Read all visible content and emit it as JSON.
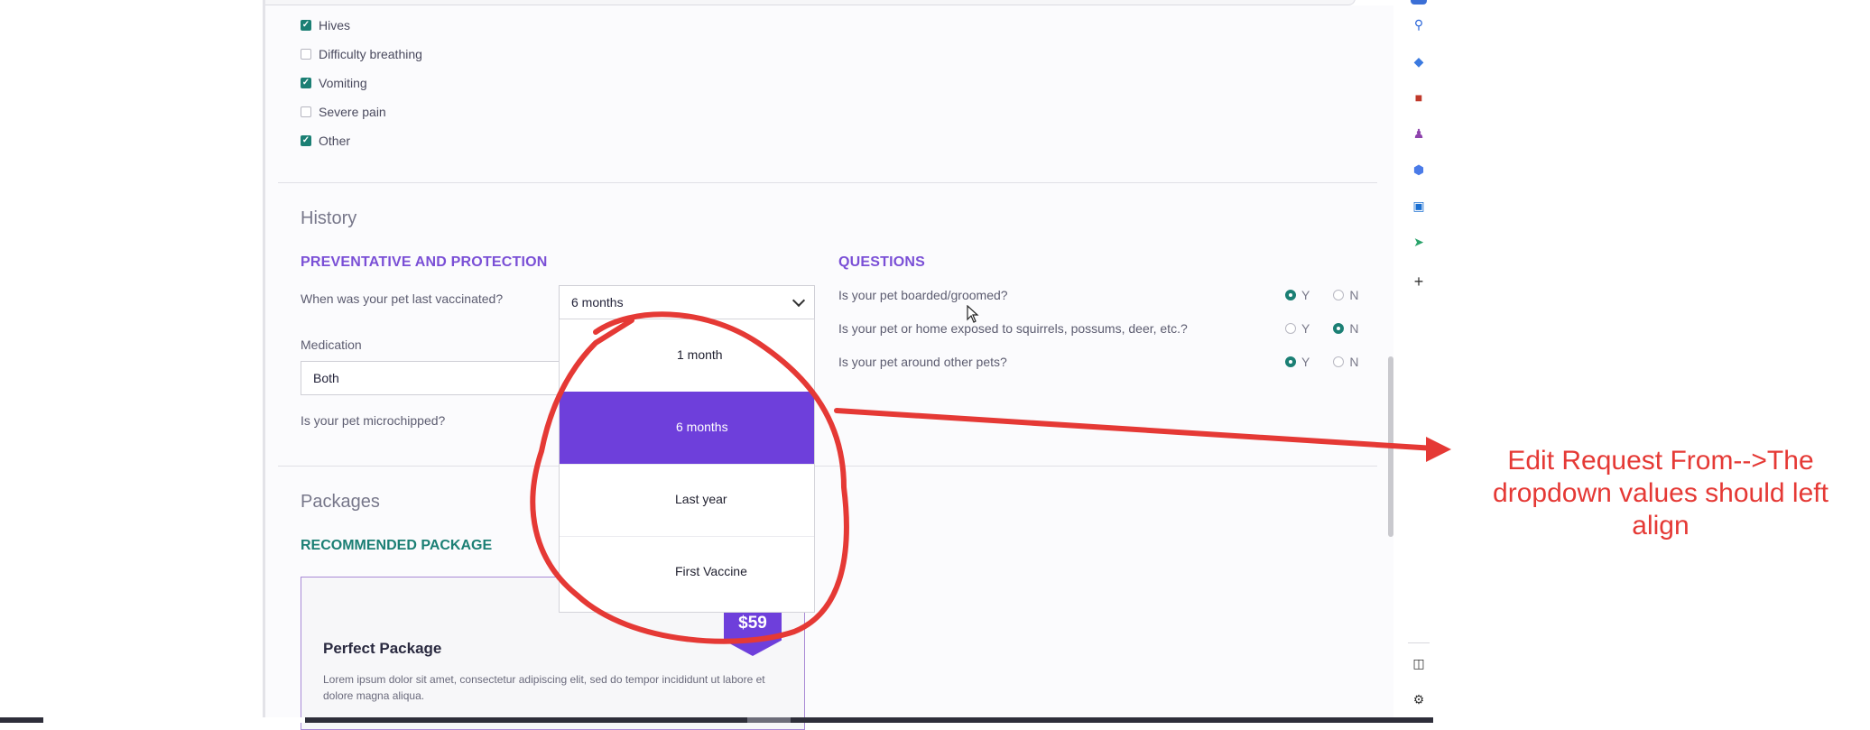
{
  "symptoms": [
    {
      "label": "Hives",
      "checked": true
    },
    {
      "label": "Difficulty breathing",
      "checked": false
    },
    {
      "label": "Vomiting",
      "checked": true
    },
    {
      "label": "Severe pain",
      "checked": false
    },
    {
      "label": "Other",
      "checked": true
    }
  ],
  "history": {
    "title": "History",
    "preventative": {
      "heading": "PREVENTATIVE AND PROTECTION",
      "vaccinated_question": "When was your pet last vaccinated?",
      "vaccinated_value": "6 months",
      "medication_label": "Medication",
      "medication_value": "Both",
      "microchipped_question": "Is your pet microchipped?"
    },
    "vaccination_dropdown": {
      "options": [
        "1 month",
        "6 months",
        "Last year",
        "First Vaccine"
      ],
      "selected": "6 months",
      "highlight_color": "#6e3fdb"
    },
    "questions": {
      "heading": "QUESTIONS",
      "items": [
        {
          "text": "Is your pet boarded/groomed?",
          "yes_label": "Y",
          "no_label": "N",
          "answer": "Y"
        },
        {
          "text": "Is your pet or home exposed to squirrels, possums, deer, etc.?",
          "yes_label": "Y",
          "no_label": "N",
          "answer": "N"
        },
        {
          "text": "Is your pet around other pets?",
          "yes_label": "Y",
          "no_label": "N",
          "answer": "Y"
        }
      ]
    }
  },
  "packages": {
    "title": "Packages",
    "recommended_heading": "RECOMMENDED PACKAGE",
    "card": {
      "name": "Perfect Package",
      "price": "$59",
      "description": "Lorem ipsum dolor sit amet, consectetur adipiscing elit, sed do tempor incididunt ut labore et dolore magna aliqua."
    }
  },
  "sidebar_icons": [
    "search-icon",
    "tag-icon",
    "briefcase-icon",
    "chess-icon",
    "copilot-icon",
    "outlook-icon",
    "send-icon",
    "add-icon",
    "panel-icon",
    "gear-icon"
  ],
  "annotation": {
    "text": "Edit Request From-->The dropdown values should left align",
    "color": "#e53935"
  },
  "colors": {
    "accent_purple": "#7a4fd6",
    "accent_teal": "#1b7f74"
  }
}
